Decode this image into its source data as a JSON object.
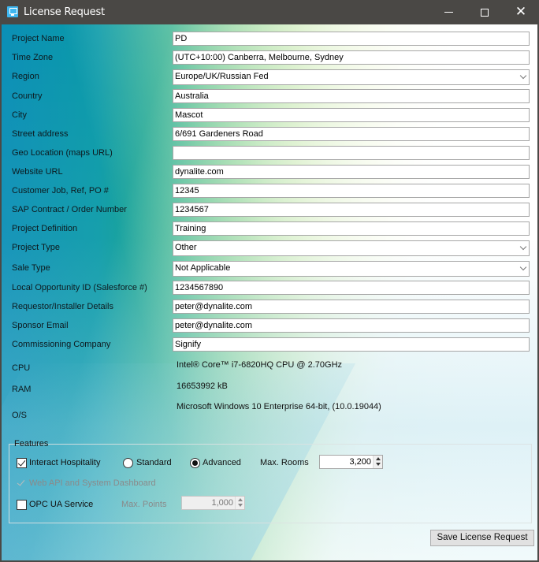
{
  "window": {
    "title": "License Request",
    "controls": {
      "minimize": "minimize",
      "maximize": "maximize",
      "close": "✕"
    }
  },
  "form": {
    "fields": [
      {
        "label": "Project Name",
        "value": "PD",
        "type": "text"
      },
      {
        "label": "Time Zone",
        "value": "(UTC+10:00) Canberra, Melbourne, Sydney",
        "type": "text"
      },
      {
        "label": "Region",
        "value": "Europe/UK/Russian Fed",
        "type": "combo"
      },
      {
        "label": "Country",
        "value": "Australia",
        "type": "text"
      },
      {
        "label": "City",
        "value": "Mascot",
        "type": "text"
      },
      {
        "label": "Street address",
        "value": "6/691 Gardeners Road",
        "type": "text"
      },
      {
        "label": "Geo Location (maps URL)",
        "value": "",
        "type": "text"
      },
      {
        "label": "Website URL",
        "value": "dynalite.com",
        "type": "text"
      },
      {
        "label": "Customer Job, Ref, PO #",
        "value": "12345",
        "type": "text"
      },
      {
        "label": "SAP Contract / Order Number",
        "value": "1234567",
        "type": "text"
      },
      {
        "label": "Project Definition",
        "value": "Training",
        "type": "text"
      },
      {
        "label": "Project Type",
        "value": "Other",
        "type": "combo"
      },
      {
        "label": "Sale Type",
        "value": "Not Applicable",
        "type": "combo"
      },
      {
        "label": "Local Opportunity ID (Salesforce #)",
        "value": "1234567890",
        "type": "text"
      },
      {
        "label": "Requestor/Installer Details",
        "value": "peter@dynalite.com",
        "type": "text"
      },
      {
        "label": "Sponsor Email",
        "value": "peter@dynalite.com",
        "type": "text"
      },
      {
        "label": "Commissioning Company",
        "value": "Signify",
        "type": "text"
      }
    ],
    "system": {
      "cpu_label": "CPU",
      "cpu_value": "Intel® Core™ i7-6820HQ CPU @ 2.70GHz",
      "ram_label": "RAM",
      "ram_value": "16653992 kB",
      "os_label": "O/S",
      "os_value": "Microsoft Windows 10 Enterprise 64-bit,  (10.0.19044)"
    }
  },
  "features": {
    "legend": "Features",
    "interact_hospitality": {
      "label": "Interact Hospitality",
      "checked": true
    },
    "standard": {
      "label": "Standard",
      "selected": false
    },
    "advanced": {
      "label": "Advanced",
      "selected": true
    },
    "max_rooms": {
      "label": "Max. Rooms",
      "value": "3,200"
    },
    "web_api": {
      "label": "Web API and System Dashboard",
      "checked": true,
      "disabled": true
    },
    "opc_ua": {
      "label": "OPC UA Service",
      "checked": false
    },
    "max_points": {
      "label": "Max. Points",
      "value": "1,000",
      "disabled": true
    }
  },
  "actions": {
    "save_label": "Save License Request"
  }
}
